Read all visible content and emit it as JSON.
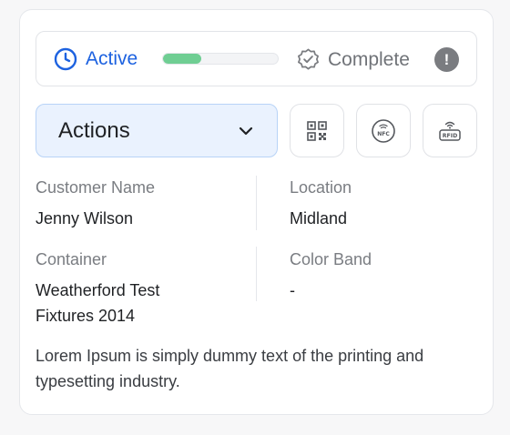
{
  "status": {
    "current_label": "Active",
    "progress_percent": 33,
    "complete_label": "Complete",
    "info_symbol": "!",
    "colors": {
      "active": "#1d62e0",
      "progress": "#6fce93",
      "complete": "#707378"
    },
    "icons": {
      "active": "clock-icon",
      "complete": "badge-check-icon",
      "info": "info-icon"
    }
  },
  "actions": {
    "label": "Actions",
    "chevron_icon": "chevron-down-icon",
    "tool_buttons": [
      {
        "name": "qr-code-button",
        "icon": "qr-code-icon"
      },
      {
        "name": "nfc-button",
        "icon": "nfc-icon",
        "icon_text": "NFC"
      },
      {
        "name": "rfid-button",
        "icon": "rfid-icon",
        "icon_text": "RFID"
      }
    ]
  },
  "fields": {
    "customer_name": {
      "label": "Customer Name",
      "value": "Jenny Wilson"
    },
    "location": {
      "label": "Location",
      "value": "Midland"
    },
    "container": {
      "label": "Container",
      "value_line1": "Weatherford Test",
      "value_line2": "Fixtures 2014"
    },
    "color_band": {
      "label": "Color Band",
      "value": "-"
    }
  },
  "description": {
    "line1": "Lorem Ipsum is simply dummy text of the printing and",
    "line2": "typesetting industry."
  }
}
